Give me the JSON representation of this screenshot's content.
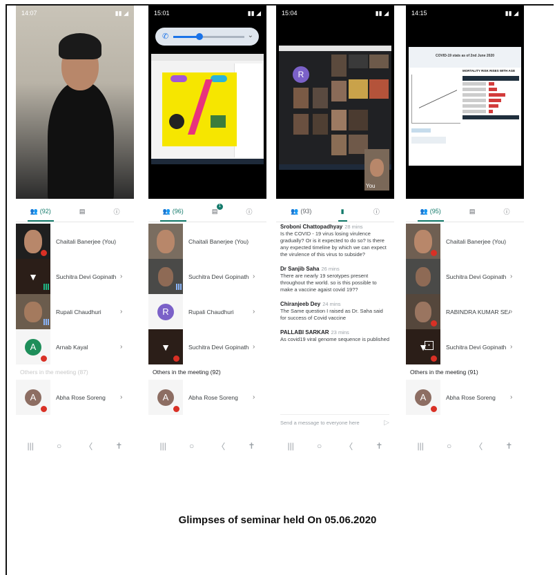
{
  "caption": "Glimpses of seminar held On 05.06.2020",
  "colors": {
    "accent": "#137a6b",
    "mute": "#d93025",
    "slide_yellow": "#f6e600"
  },
  "phones": [
    {
      "status_time": "14:07",
      "tabs": {
        "people_count": "(92)"
      },
      "participants": [
        {
          "name": "Chaitali Banerjee (You)",
          "tile": "photo"
        },
        {
          "name": "Suchitra Devi Gopinath",
          "tile": "pin"
        },
        {
          "name": "Rupali Chaudhuri",
          "tile": "photo"
        },
        {
          "name": "Arnab Kayal",
          "tile": "avatar",
          "initial": "A",
          "avatar_color": "#1e8e5a"
        }
      ],
      "others_label": "Others in the meeting (87)",
      "others": [
        {
          "name": "Abha Rose Soreng",
          "initial": "A",
          "avatar_color": "#8d6e63"
        }
      ]
    },
    {
      "status_time": "15:01",
      "tabs": {
        "people_count": "(96)",
        "chat_badge": "1"
      },
      "participants": [
        {
          "name": "Chaitali Banerjee (You)",
          "tile": "photo"
        },
        {
          "name": "Suchitra Devi Gopinath",
          "tile": "photo"
        },
        {
          "name": "Rupali Chaudhuri",
          "tile": "avatar",
          "initial": "R",
          "avatar_color": "#7b61c8"
        },
        {
          "name": "Suchitra Devi Gopinath",
          "tile": "pin"
        }
      ],
      "others_label": "Others in the meeting (92)",
      "others": [
        {
          "name": "Abha Rose Soreng",
          "initial": "A",
          "avatar_color": "#8d6e63"
        }
      ]
    },
    {
      "status_time": "15:04",
      "tabs": {
        "people_count": "(93)"
      },
      "you_label": "You",
      "messages": [
        {
          "author": "Sroboni Chattopadhyay",
          "time": "28 mins",
          "text": "Is the COVID - 19 virus losing virulence gradually? Or is it expected to do so? Is there any expected timeline by which we can expect the virulence of this virus to subside?"
        },
        {
          "author": "Dr Sanjib Saha",
          "time": "26 mins",
          "text": "There are nearly 19 serotypes present throughout the world. so is this possible to make a vaccine agaist covid 19??"
        },
        {
          "author": "Chiranjeeb Dey",
          "time": "24 mins",
          "text": "The Same question I raised as Dr. Saha said for success of Covid vaccine"
        },
        {
          "author": "PALLABI SARKAR",
          "time": "23 mins",
          "text": "As covid19 viral genome sequence is published"
        }
      ],
      "send_placeholder": "Send a message to everyone here"
    },
    {
      "status_time": "14:15",
      "tabs": {
        "people_count": "(95)"
      },
      "slide_title": "COVID-19 stats as of 2nd June 2020",
      "chart_heading": "MORTALITY RISK RISES WITH AGE",
      "participants": [
        {
          "name": "Chaitali Banerjee (You)",
          "tile": "photo"
        },
        {
          "name": "Suchitra Devi Gopinath",
          "tile": "photo"
        },
        {
          "name": "RABINDRA KUMAR SEAL",
          "tile": "photo"
        },
        {
          "name": "Suchitra Devi Gopinath",
          "tile": "pin"
        }
      ],
      "others_label": "Others in the meeting (91)",
      "others": [
        {
          "name": "Abha Rose Soreng",
          "initial": "A",
          "avatar_color": "#8d6e63"
        }
      ]
    }
  ],
  "icons": {
    "people": "people-icon",
    "chat": "chat-icon",
    "info": "info-icon",
    "chevron": "chevron-right-icon"
  },
  "navbar": {
    "recents": "|||",
    "home": "○",
    "back": "〈",
    "accessibility": "✝"
  }
}
